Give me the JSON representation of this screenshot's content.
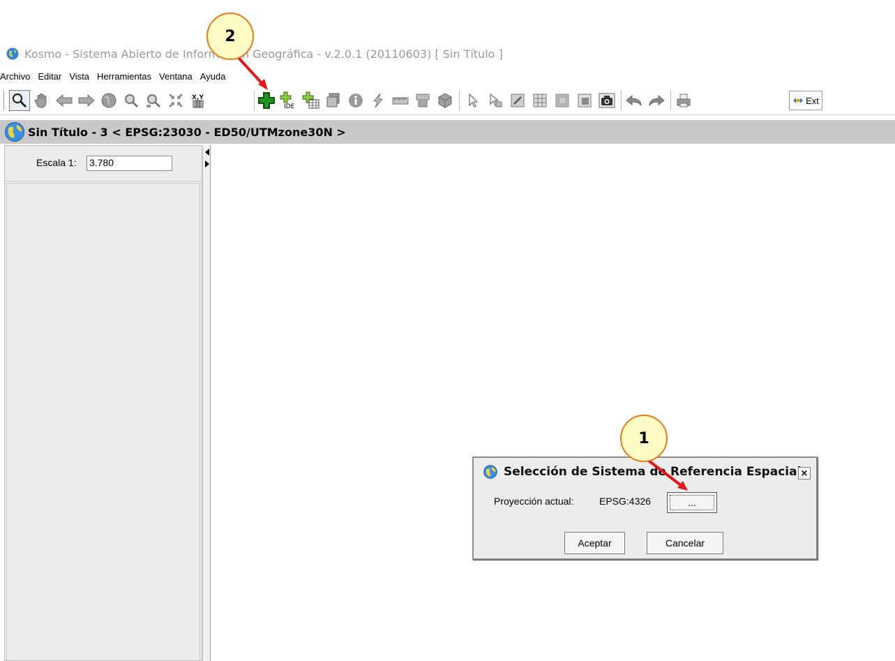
{
  "app": {
    "title": "Kosmo - Sistema Abierto de Información Geográfica - v.2.0.1 (20110603)  [ Sin Título ]"
  },
  "menu": {
    "items": [
      "Archivo",
      "Editar",
      "Vista",
      "Herramientas",
      "Ventana",
      "Ayuda"
    ]
  },
  "toolbar": {
    "ext_label": "Ext",
    "tools": [
      "zoom-icon",
      "pan-hand-icon",
      "previous-view-icon",
      "next-view-icon",
      "full-extent-globe-icon",
      "zoom-in-icon",
      "zoom-out-icon",
      "zoom-to-layer-icon",
      "go-to-xy-icon",
      "add-layer-icon",
      "add-ide-layer-icon",
      "add-table-icon",
      "layer-properties-icon",
      "info-icon",
      "hyperlink-icon",
      "measure-ruler-icon",
      "measure-area-icon",
      "3d-box-icon",
      "select-pointer-icon",
      "select-by-shape-icon",
      "edit-icon",
      "grid-icon",
      "raster-icon",
      "overview-icon",
      "snapshot-camera-icon",
      "undo-icon",
      "redo-icon",
      "print-icon"
    ]
  },
  "view": {
    "title": "Sin Título - 3 < EPSG:23030 - ED50/UTMzone30N >"
  },
  "left_panel": {
    "scale_label": "Escala 1:",
    "scale_value": "3.780"
  },
  "dialog": {
    "title": "Selección de Sistema de Referencia Espacial",
    "close_label": "×",
    "projection_label": "Proyección actual:",
    "projection_value": "EPSG:4326",
    "browse_label": "...",
    "accept_label": "Aceptar",
    "cancel_label": "Cancelar"
  },
  "callouts": {
    "one": "1",
    "two": "2"
  },
  "colors": {
    "callout_fill": "#fffbc4",
    "callout_border": "#e87818",
    "arrow": "#e01818",
    "view_bar": "#c9c9c9"
  }
}
